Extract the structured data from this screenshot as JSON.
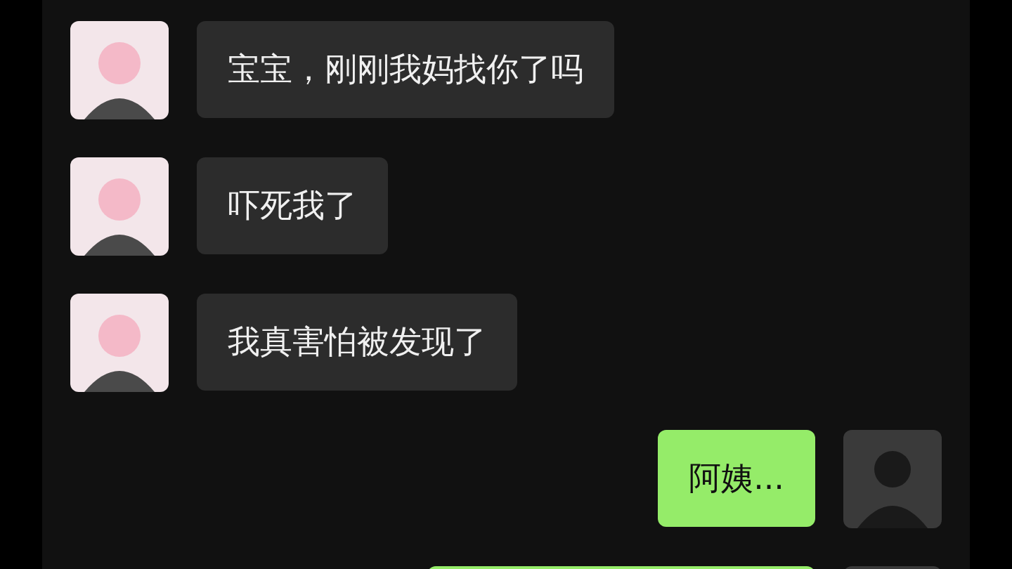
{
  "messages": [
    {
      "kind": "incoming",
      "text": "宝宝，刚刚我妈找你了吗"
    },
    {
      "kind": "incoming",
      "text": "吓死我了"
    },
    {
      "kind": "incoming",
      "text": "我真害怕被发现了"
    },
    {
      "kind": "outgoing",
      "text": "阿姨..."
    },
    {
      "kind": "outgoing"
    }
  ]
}
